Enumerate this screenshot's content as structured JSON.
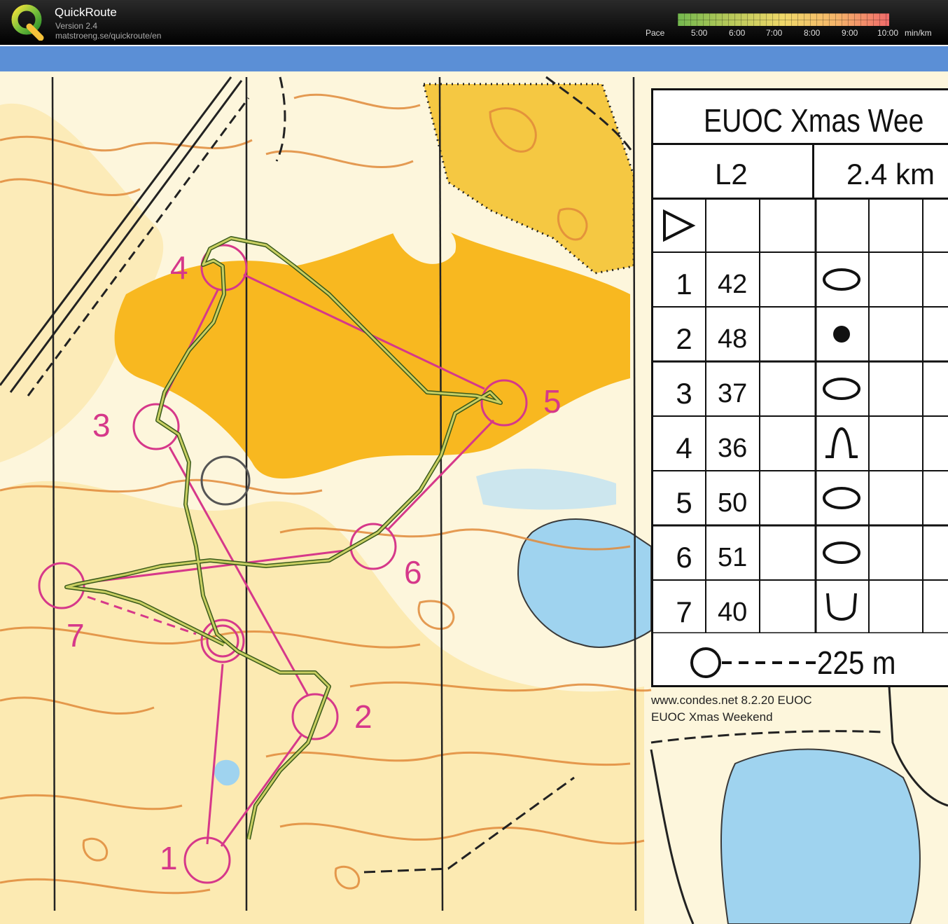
{
  "app": {
    "name": "QuickRoute",
    "version": "Version 2.4",
    "url": "matstroeng.se/quickroute/en"
  },
  "pace": {
    "label": "Pace",
    "ticks": [
      "5:00",
      "6:00",
      "7:00",
      "8:00",
      "9:00",
      "10:00"
    ],
    "unit": "min/km"
  },
  "legend": {
    "title": "EUOC Xmas Wee",
    "course": "L2",
    "length": "2.4 km",
    "controls": [
      {
        "num": "1",
        "code": "42",
        "symbol": "oval"
      },
      {
        "num": "2",
        "code": "48",
        "symbol": "dot"
      },
      {
        "num": "3",
        "code": "37",
        "symbol": "oval"
      },
      {
        "num": "4",
        "code": "36",
        "symbol": "knoll"
      },
      {
        "num": "5",
        "code": "50",
        "symbol": "oval"
      },
      {
        "num": "6",
        "code": "51",
        "symbol": "oval"
      },
      {
        "num": "7",
        "code": "40",
        "symbol": "cup"
      }
    ],
    "finish_distance": "225 m"
  },
  "credits": {
    "line1": "www.condes.net 8.2.20 EUOC",
    "line2": "EUOC Xmas Weekend"
  },
  "controls_on_map": [
    "1",
    "2",
    "3",
    "4",
    "5",
    "6",
    "7"
  ],
  "colors": {
    "course": "#d6388a",
    "route": "#6aa24a",
    "contour": "#e08a3a",
    "water": "#9fd3ef",
    "rough_open": "#f8b820"
  }
}
